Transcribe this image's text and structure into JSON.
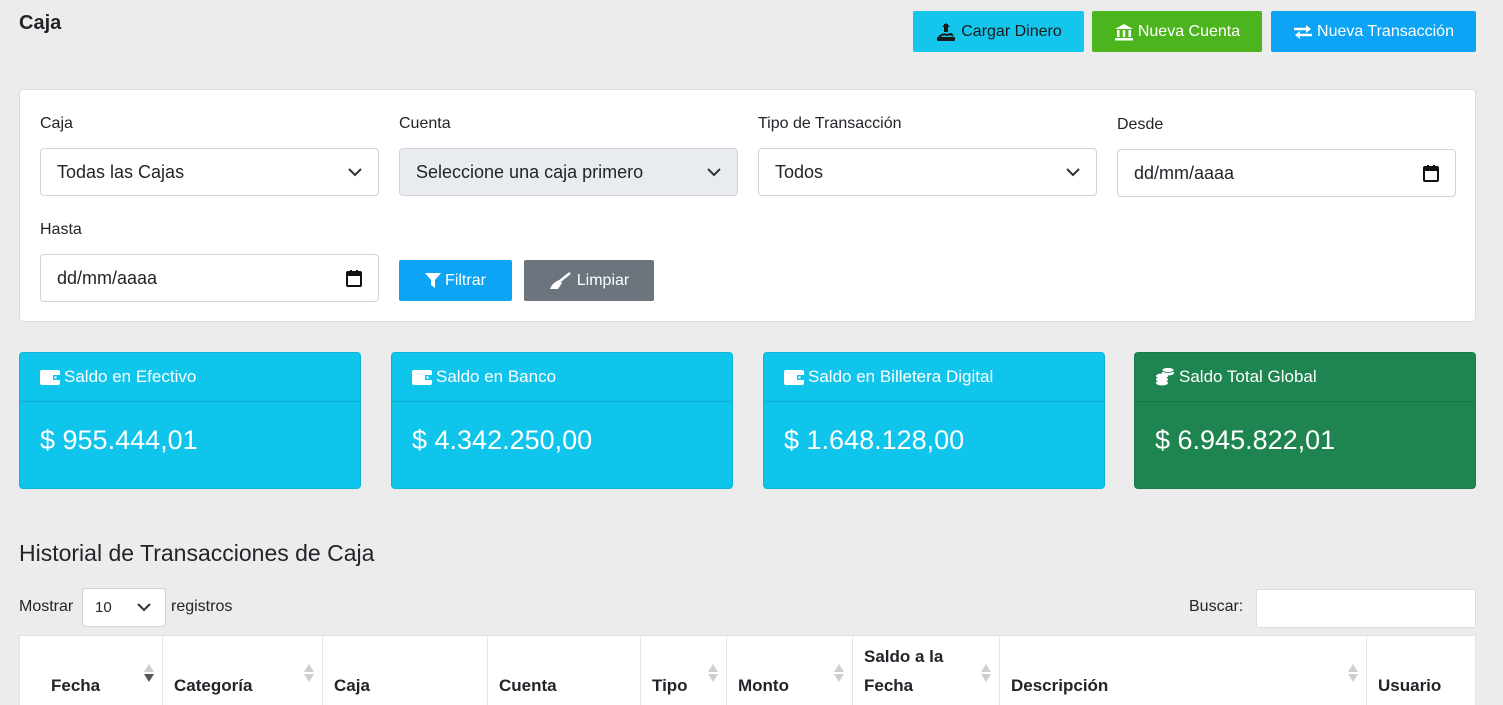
{
  "page": {
    "title": "Caja"
  },
  "actions": {
    "cargar_dinero": "Cargar Dinero",
    "nueva_cuenta": "Nueva Cuenta",
    "nueva_transaccion": "Nueva Transacción"
  },
  "filters": {
    "caja": {
      "label": "Caja",
      "value": "Todas las Cajas"
    },
    "cuenta": {
      "label": "Cuenta",
      "value": "Seleccione una caja primero"
    },
    "tipo": {
      "label": "Tipo de Transacción",
      "value": "Todos"
    },
    "desde": {
      "label": "Desde",
      "value": "dd/mm/aaaa"
    },
    "hasta": {
      "label": "Hasta",
      "value": "dd/mm/aaaa"
    },
    "filtrar_label": "Filtrar",
    "limpiar_label": "Limpiar"
  },
  "balances": [
    {
      "label": "Saldo en Efectivo",
      "amount": "$ 955.444,01",
      "icon": "wallet-icon",
      "color": "#10c5ec"
    },
    {
      "label": "Saldo en Banco",
      "amount": "$ 4.342.250,00",
      "icon": "wallet-icon",
      "color": "#10c5ec"
    },
    {
      "label": "Saldo en Billetera Digital",
      "amount": "$ 1.648.128,00",
      "icon": "wallet-icon",
      "color": "#10c5ec"
    },
    {
      "label": "Saldo Total Global",
      "amount": "$ 6.945.822,01",
      "icon": "coins-icon",
      "color": "#1f8550"
    }
  ],
  "history": {
    "title": "Historial de Transacciones de Caja",
    "show_label": "Mostrar",
    "page_length": "10",
    "records_label": "registros",
    "search_label": "Buscar:",
    "search_value": "",
    "columns": [
      {
        "line1": "",
        "line2": "Fecha",
        "sortable": true,
        "sorted": "desc"
      },
      {
        "line1": "",
        "line2": "Categoría",
        "sortable": true
      },
      {
        "line1": "",
        "line2": "Caja",
        "sortable": false
      },
      {
        "line1": "",
        "line2": "Cuenta",
        "sortable": false
      },
      {
        "line1": "",
        "line2": "Tipo",
        "sortable": true
      },
      {
        "line1": "",
        "line2": "Monto",
        "sortable": true
      },
      {
        "line1": "Saldo a la",
        "line2": "Fecha",
        "sortable": true
      },
      {
        "line1": "",
        "line2": "Descripción",
        "sortable": true
      },
      {
        "line1": "",
        "line2": "Usuario",
        "sortable": false
      }
    ]
  }
}
